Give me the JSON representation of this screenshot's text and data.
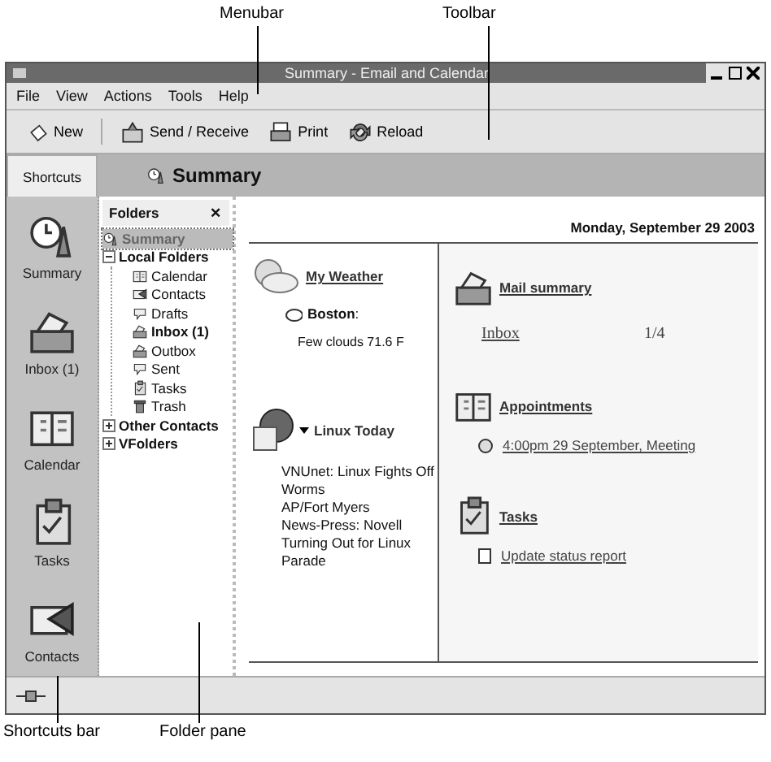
{
  "callouts": [
    {
      "label": "Menubar"
    },
    {
      "label": "Toolbar"
    },
    {
      "label": "Shortcuts bar"
    },
    {
      "label": "Folder pane"
    }
  ],
  "window": {
    "title": "Summary - Email and Calendar"
  },
  "menubar": [
    "File",
    "View",
    "Actions",
    "Tools",
    "Help"
  ],
  "toolbar": [
    {
      "label": "New"
    },
    {
      "label": "Send / Receive"
    },
    {
      "label": "Print"
    },
    {
      "label": "Reload"
    }
  ],
  "shortcuts": {
    "tab": "Shortcuts",
    "items": [
      {
        "label": "Summary"
      },
      {
        "label": "Inbox (1)"
      },
      {
        "label": "Calendar"
      },
      {
        "label": "Tasks"
      },
      {
        "label": "Contacts"
      }
    ]
  },
  "folders": {
    "title": "Folders",
    "close": "✕",
    "tree": [
      {
        "label": "Summary",
        "selected": true,
        "unread": true
      },
      {
        "label": "Local Folders",
        "selected": false,
        "unread": true,
        "expanded": true,
        "children": [
          {
            "label": "Calendar",
            "selected": false,
            "unread": false
          },
          {
            "label": "Contacts",
            "selected": false,
            "unread": false
          },
          {
            "label": "Drafts",
            "selected": false,
            "unread": false
          },
          {
            "label": "Inbox (1)",
            "selected": false,
            "unread": true
          },
          {
            "label": "Outbox",
            "selected": false,
            "unread": false
          },
          {
            "label": "Sent",
            "selected": false,
            "unread": false
          },
          {
            "label": "Tasks",
            "selected": false,
            "unread": false
          },
          {
            "label": "Trash",
            "selected": false,
            "unread": false
          }
        ]
      },
      {
        "label": "Other Contacts",
        "selected": false,
        "unread": true,
        "expanded": false
      },
      {
        "label": "VFolders",
        "selected": false,
        "unread": true,
        "expanded": false
      }
    ]
  },
  "summary": {
    "title": "Summary",
    "date": "Monday, September 29 2003",
    "weather": {
      "heading": "My Weather",
      "city": "**Boston**:",
      "conditions": "Few clouds 71.6 F"
    },
    "news": {
      "heading": "Linux Today",
      "expanded": true,
      "items": [
        "VNUnet: Linux Fights Off Worms",
        "AP/Fort Myers",
        "News-Press: Novell Turning Out for Linux Parade"
      ]
    },
    "mail": {
      "heading": "Mail summary",
      "rows": [
        {
          "folder": "Inbox",
          "count": "1/4"
        }
      ]
    },
    "appointments": {
      "heading": "Appointments",
      "items": [
        "4:00pm 29 September, Meeting"
      ]
    },
    "tasks": {
      "heading": "Tasks",
      "items": [
        "Update status report"
      ]
    }
  }
}
